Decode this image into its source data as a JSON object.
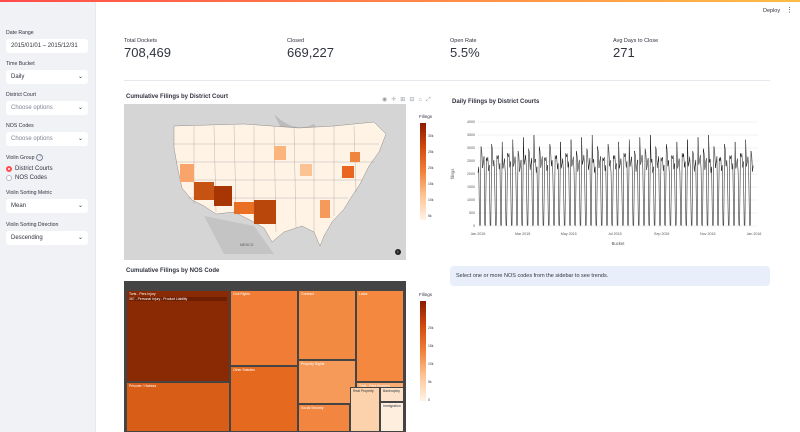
{
  "header": {
    "deploy_label": "Deploy",
    "menu_icon": "kebab-menu-icon"
  },
  "sidebar": {
    "date_range_label": "Date Range",
    "date_range_value": "2015/01/01 – 2015/12/31",
    "time_bucket_label": "Time Bucket",
    "time_bucket_value": "Daily",
    "district_court_label": "District Court",
    "district_court_placeholder": "Choose options",
    "nos_codes_label": "NOS Codes",
    "nos_codes_placeholder": "Choose options",
    "violin_group_label": "Violin Group",
    "violin_group_options": [
      "District Courts",
      "NOS Codes"
    ],
    "violin_group_selected": "District Courts",
    "violin_metric_label": "Violin Sorting Metric",
    "violin_metric_value": "Mean",
    "violin_direction_label": "Violin Sorting Direction",
    "violin_direction_value": "Descending"
  },
  "metrics": [
    {
      "label": "Total Dockets",
      "value": "708,469"
    },
    {
      "label": "Closed",
      "value": "669,227"
    },
    {
      "label": "Open Rate",
      "value": "5.5%"
    },
    {
      "label": "Avg Days to Close",
      "value": "271"
    }
  ],
  "map_chart": {
    "title": "Cumulative Filings by District Court",
    "colorbar_label": "Filings",
    "colorbar_ticks": [
      "30k",
      "25k",
      "20k",
      "15k",
      "10k",
      "5k"
    ],
    "country_label": "MEXICO",
    "info_icon": "info-icon"
  },
  "toolbar_icons": [
    "camera-icon",
    "pan-icon",
    "zoom-in-icon",
    "zoom-out-icon",
    "home-icon",
    "fullscreen-icon"
  ],
  "treemap_chart": {
    "title": "Cumulative Filings by NOS Code",
    "colorbar_label": "Filings",
    "colorbar_ticks": [
      "20k",
      "15k",
      "10k",
      "5k",
      "0"
    ],
    "cells": [
      {
        "label": "Torts - Pers Injury",
        "sub": "367 - Personal Injury - Product Liability"
      },
      {
        "label": "Civil Rights"
      },
      {
        "label": "Contract"
      },
      {
        "label": "Labor"
      },
      {
        "label": "Prisoner / Habeas"
      },
      {
        "label": "Other Statutes"
      },
      {
        "label": "Property Rights"
      },
      {
        "label": "Torts - Pers Property"
      },
      {
        "label": "Social Security"
      },
      {
        "label": "Real Property"
      },
      {
        "label": "Bankruptcy"
      },
      {
        "label": "Immigration"
      }
    ]
  },
  "info_message": "Select one or more NOS codes from the sidebar to see trends.",
  "chart_data": {
    "type": "line",
    "title": "Daily Filings by District Courts",
    "xlabel": "Bucket",
    "ylabel": "filings",
    "x_ticks": [
      "Jan 2015",
      "Mar 2015",
      "May 2015",
      "Jul 2015",
      "Sep 2015",
      "Nov 2015",
      "Jan 2016"
    ],
    "y_ticks": [
      "0",
      "500",
      "1000",
      "1500",
      "2000",
      "2500",
      "3000",
      "3500",
      "4000"
    ],
    "ylim": [
      0,
      4000
    ],
    "x_range": [
      "2015-01-01",
      "2015-12-31"
    ],
    "weekly_pattern": [
      3200,
      2700,
      2550,
      2500,
      2450,
      30,
      20
    ],
    "grid": true
  }
}
